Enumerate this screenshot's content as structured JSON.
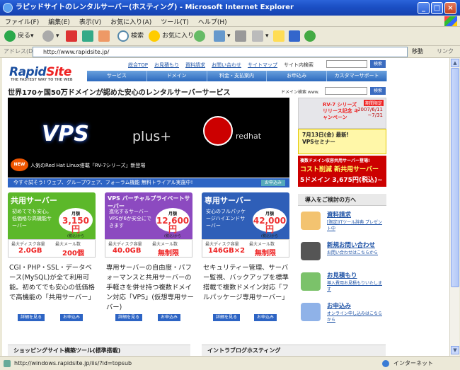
{
  "window": {
    "title": "ラピッドサイトのレンタルサーバー(ホスティング) - Microsoft Internet Explorer",
    "min": "_",
    "max": "□",
    "close": "×"
  },
  "menu": [
    "ファイル(F)",
    "編集(E)",
    "表示(V)",
    "お気に入り(A)",
    "ツール(T)",
    "ヘルプ(H)"
  ],
  "toolbar": {
    "back": "戻る",
    "search": "検索",
    "favorites": "お気に入り"
  },
  "address": {
    "label": "アドレス(D)",
    "url": "http://www.rapidsite.jp/",
    "go": "移動",
    "links": "リンク"
  },
  "site": {
    "logo_a": "Rapid",
    "logo_b": "Site",
    "slogan": "THE FASTEST WAY TO THE WEB",
    "toplinks": [
      "総合TOP",
      "お見積もり",
      "資料請求",
      "お問い合わせ",
      "サイトマップ",
      "サイト内検索"
    ],
    "search_btn": "検索",
    "nav": [
      "サービス",
      "ドメイン",
      "料金・支払案内",
      "お申込み",
      "カスタマーサポート"
    ],
    "headline": "世界170ヶ国50万ドメインが認めた安心のレンタルサーバーサービス",
    "domain_search": "ドメイン検索 www.",
    "banner": {
      "vps": "VPS",
      "plus": "plus+",
      "redhat": "redhat",
      "new": "NEW",
      "caption": "人気のRed Hat Linux搭載「RV-7シリーズ」新登場"
    },
    "trial": "今すぐ試そう! ウェブ、グループウェア、フォーラム機能 無料トライアル実施中!",
    "trial_btn": "お申込み",
    "side": {
      "rv7_tag": "期間限定",
      "rv7_title": "RV-7 シリーズ リリース記念 キャンペーン",
      "rv7_date": "2007/6/11 ~7/31",
      "seminar": "7月13日(金) 最新! VPSセミナー",
      "cost_a": "複数ドメイン収容共用サーバー登場!",
      "cost_b": "コスト削減 新共用サーバー",
      "cost_c": "5ドメイン 3,675円(税込)~"
    },
    "plans": [
      {
        "name": "共用サーバー",
        "desc": "初めてでも安心。低価格な高機能サーバー",
        "monthly": "月額",
        "price": "3,150円",
        "tax": "(税込)から",
        "disk_label": "最大ディスク容量",
        "disk": "2.0GB",
        "mail_label": "最大メール数",
        "mail": "200個",
        "text": "CGI・PHP・SSL・データベース(MySQL)が全て利用可能。初めてでも安心の低価格で高機能の「共用サーバー」",
        "btn1": "詳細を見る",
        "btn2": "お申込み"
      },
      {
        "name": "VPS バーチャルプライベートサーバー",
        "desc": "進化するサーバー VPSが6か安全にできます",
        "monthly": "月額",
        "price": "12,600円",
        "tax": "(税込)から",
        "disk_label": "最大ディスク容量",
        "disk": "40.0GB",
        "mail_label": "最大メール数",
        "mail": "無制限",
        "text": "専用サーバーの自由度・パフォーマンスと共用サーバーの手軽さを併せ持つ複数ドメイン対応「VPS」(仮想専用サーバー)",
        "btn1": "詳細を見る",
        "btn2": "お申込み"
      },
      {
        "name": "専用サーバー",
        "desc": "安心のフルパッケージハイエンドサーバー",
        "monthly": "月額",
        "price": "42,000円",
        "tax": "(税込)から",
        "disk_label": "最大ディスク容量",
        "disk": "146GB×2",
        "mail_label": "最大メール数",
        "mail": "無制限",
        "text": "セキュリティー管理、サーバー監視、バックアップを標準搭載で複数ドメイン対応「フルパッケージ専用サーバー」",
        "btn1": "詳細を見る",
        "btn2": "お申込み"
      }
    ],
    "consider": "導入をご検討の方へ",
    "items": [
      {
        "h": "資料請求",
        "s": "[限定]ITツール辞典 プレゼント中"
      },
      {
        "h": "新規お問い合わせ",
        "s": "お問い合わせはこちらから"
      },
      {
        "h": "お見積もり",
        "s": "導入費用お見積もりいたします"
      },
      {
        "h": "お申込み",
        "s": "オンライン申し込みはこちらから"
      }
    ],
    "bottom1": "ショッピングサイト構築ツール(標準搭載)",
    "bottom2": "イントラブログホスティング"
  },
  "status": {
    "url": "http://windows.rapidsite.jp/iis/?id=topsub",
    "zone": "インターネット"
  },
  "colors": {
    "brand": "#1b4fa0",
    "accent": "#e22222",
    "nav": "#2c69be"
  }
}
